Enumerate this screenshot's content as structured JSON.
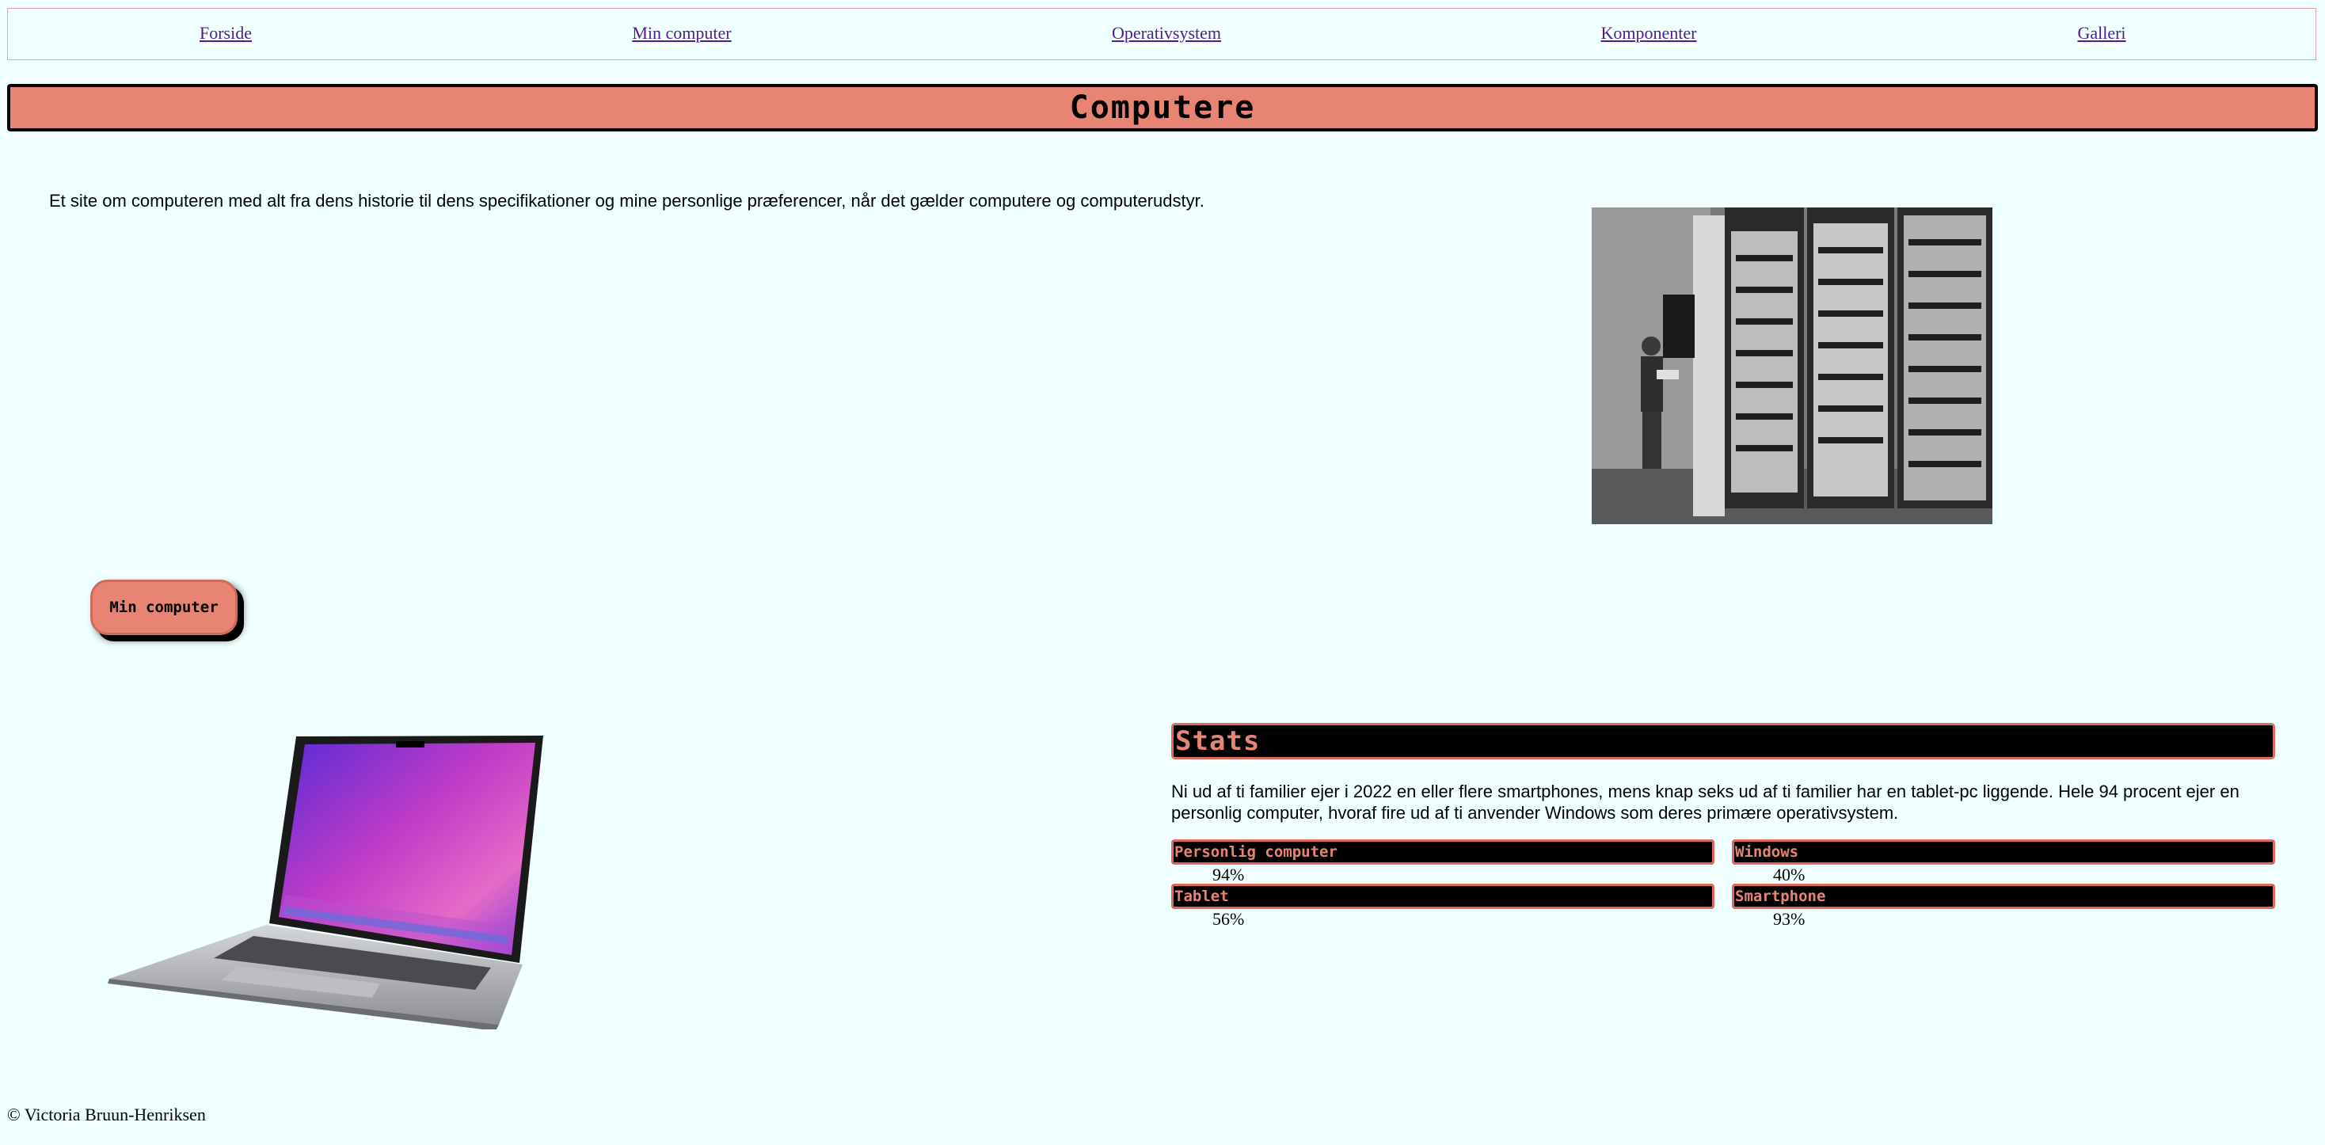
{
  "nav": {
    "items": [
      {
        "label": "Forside"
      },
      {
        "label": "Min computer"
      },
      {
        "label": "Operativsystem"
      },
      {
        "label": "Komponenter"
      },
      {
        "label": "Galleri"
      }
    ]
  },
  "header": {
    "title": "Computere"
  },
  "intro": {
    "text": "Et site om computeren med alt fra dens historie til dens specifikationer og mine personlige præferencer, når det gælder computere og computerudstyr."
  },
  "button": {
    "label": "Min computer"
  },
  "stats": {
    "heading": "Stats",
    "text": "Ni ud af ti familier ejer i 2022 en eller flere smartphones, mens knap seks ud af ti familier har en tablet-pc liggende. Hele 94 procent ejer en personlig computer, hvoraf fire ud af ti anvender Windows som deres primære operativsystem.",
    "items": [
      {
        "label": "Personlig computer",
        "value": "94%"
      },
      {
        "label": "Windows",
        "value": "40%"
      },
      {
        "label": "Tablet",
        "value": "56%"
      },
      {
        "label": "Smartphone",
        "value": "93%"
      }
    ]
  },
  "footer": {
    "text": "© Victoria Bruun-Henriksen"
  },
  "colors": {
    "background": "#f0ffff",
    "accent": "#e88474",
    "link": "#551a8b"
  }
}
